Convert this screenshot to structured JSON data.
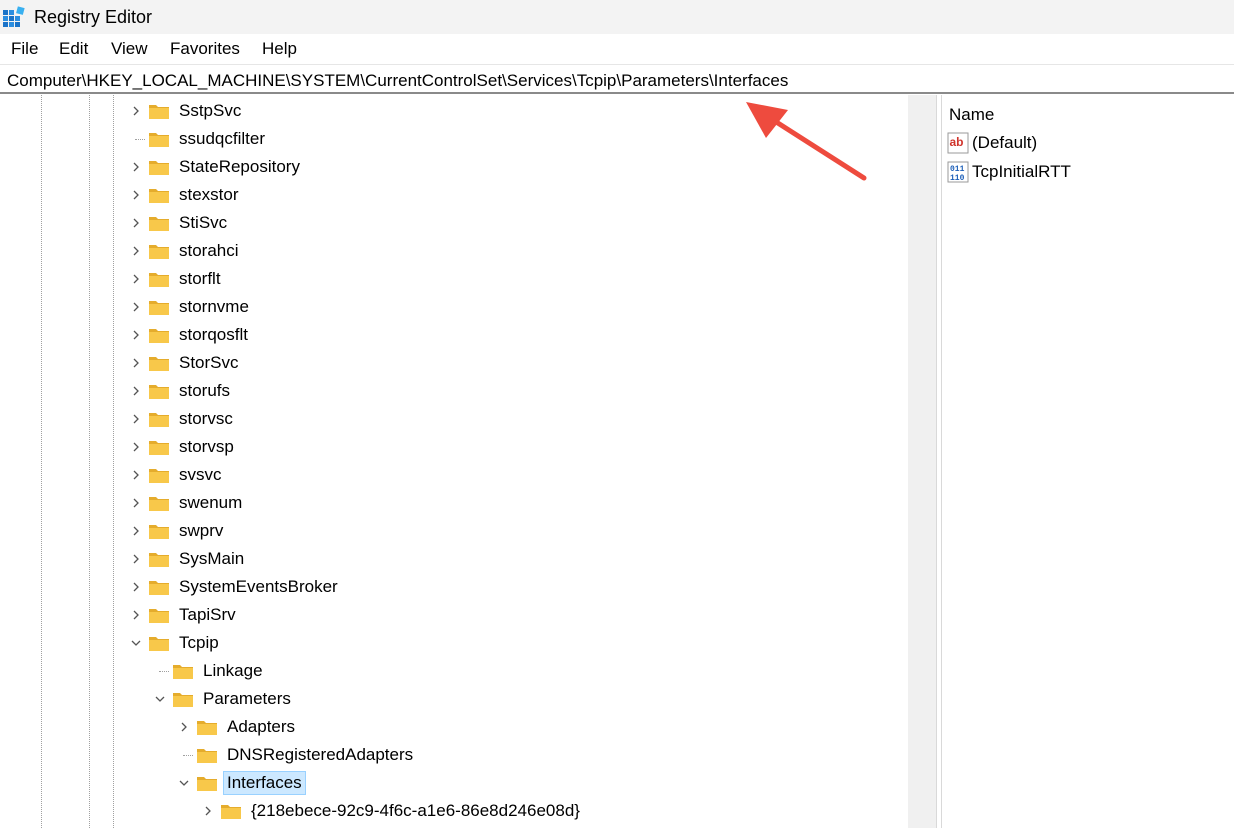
{
  "window": {
    "title": "Registry Editor"
  },
  "menu": [
    "File",
    "Edit",
    "View",
    "Favorites",
    "Help"
  ],
  "address": "Computer\\HKEY_LOCAL_MACHINE\\SYSTEM\\CurrentControlSet\\Services\\Tcpip\\Parameters\\Interfaces",
  "tree": [
    {
      "label": "SstpSvc",
      "expander": "collapsed"
    },
    {
      "label": "ssudqcfilter",
      "expander": "none"
    },
    {
      "label": "StateRepository",
      "expander": "collapsed"
    },
    {
      "label": "stexstor",
      "expander": "collapsed"
    },
    {
      "label": "StiSvc",
      "expander": "collapsed"
    },
    {
      "label": "storahci",
      "expander": "collapsed"
    },
    {
      "label": "storflt",
      "expander": "collapsed"
    },
    {
      "label": "stornvme",
      "expander": "collapsed"
    },
    {
      "label": "storqosflt",
      "expander": "collapsed"
    },
    {
      "label": "StorSvc",
      "expander": "collapsed"
    },
    {
      "label": "storufs",
      "expander": "collapsed"
    },
    {
      "label": "storvsc",
      "expander": "collapsed"
    },
    {
      "label": "storvsp",
      "expander": "collapsed"
    },
    {
      "label": "svsvc",
      "expander": "collapsed"
    },
    {
      "label": "swenum",
      "expander": "collapsed"
    },
    {
      "label": "swprv",
      "expander": "collapsed"
    },
    {
      "label": "SysMain",
      "expander": "collapsed"
    },
    {
      "label": "SystemEventsBroker",
      "expander": "collapsed"
    },
    {
      "label": "TapiSrv",
      "expander": "collapsed"
    },
    {
      "label": "Tcpip",
      "expander": "expanded"
    },
    {
      "label": "Linkage",
      "expander": "none"
    },
    {
      "label": "Parameters",
      "expander": "expanded"
    },
    {
      "label": "Adapters",
      "expander": "collapsed"
    },
    {
      "label": "DNSRegisteredAdapters",
      "expander": "none"
    },
    {
      "label": "Interfaces",
      "expander": "expanded",
      "selected": true
    },
    {
      "label": "{218ebece-92c9-4f6c-a1e6-86e8d246e08d}",
      "expander": "collapsed"
    }
  ],
  "values": {
    "header": "Name",
    "items": [
      {
        "name": "(Default)",
        "icon": "string-value-icon"
      },
      {
        "name": "TcpInitialRTT",
        "icon": "binary-value-icon"
      }
    ]
  },
  "colors": {
    "folder": "#f8c84a",
    "folder_dark": "#e5ac2c",
    "selection": "#cce8ff",
    "arrow": "#ee4b3e"
  }
}
